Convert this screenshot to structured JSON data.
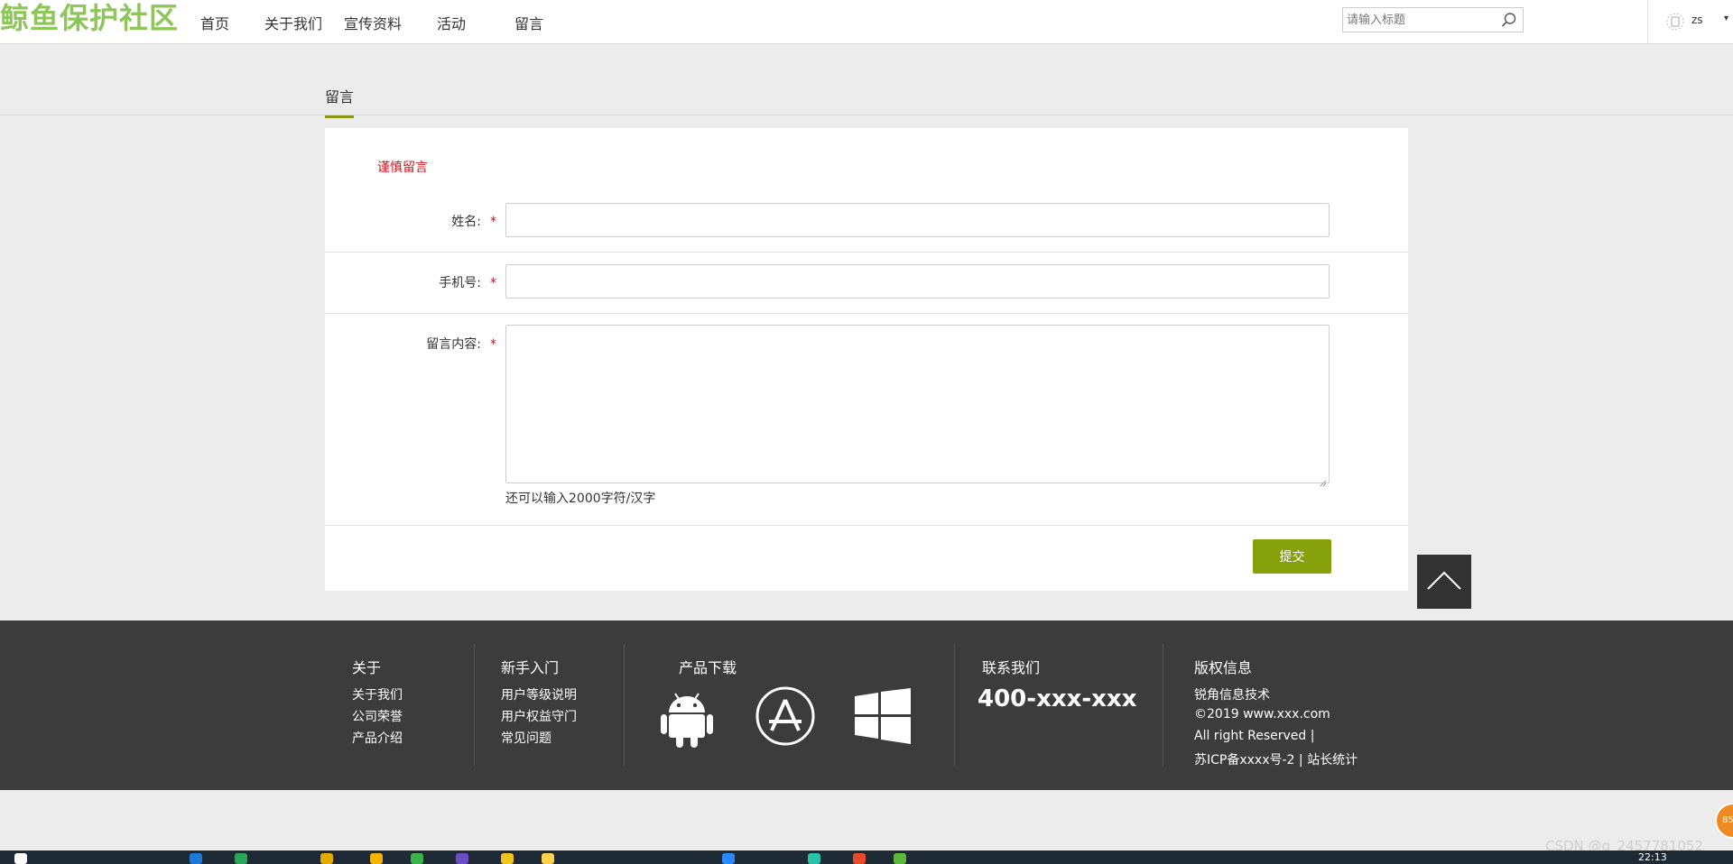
{
  "header": {
    "logo": "鲸鱼保护社区",
    "nav": [
      "首页",
      "关于我们",
      "宣传资料",
      "活动",
      "留言"
    ],
    "search_placeholder": "请输入标题",
    "username": "zs",
    "caret": "▾"
  },
  "page": {
    "tab_title": "留言"
  },
  "form": {
    "notice": "谨慎留言",
    "name_label": "姓名:",
    "phone_label": "手机号:",
    "content_label": "留言内容:",
    "required_mark": "*",
    "name_value": "",
    "phone_value": "",
    "content_value": "",
    "counter": "还可以输入2000字符/汉字",
    "submit": "提交"
  },
  "footer": {
    "about": {
      "title": "关于",
      "links": [
        "关于我们",
        "公司荣誉",
        "产品介绍"
      ]
    },
    "newbie": {
      "title": "新手入门",
      "links": [
        "用户等级说明",
        "用户权益守门",
        "常见问题"
      ]
    },
    "download": {
      "title": "产品下载",
      "icons": [
        "android-icon",
        "app-store-icon",
        "windows-icon"
      ]
    },
    "contact": {
      "title": "联系我们",
      "phone": "400-xxx-xxx"
    },
    "copyright": {
      "title": "版权信息",
      "lines": [
        "锐角信息技术",
        "©2019 www.xxx.com",
        "All right Reserved |",
        "苏ICP备xxxx号-2 | 站长统计"
      ]
    }
  },
  "overlay": {
    "watermark": "CSDN @q_2457781052",
    "time": "22:13",
    "float_ball": "85"
  },
  "colors": {
    "accent": "#86a10c",
    "logo": "#8fc65a",
    "required": "#d0101a",
    "footer_bg": "#3c3c3c"
  }
}
